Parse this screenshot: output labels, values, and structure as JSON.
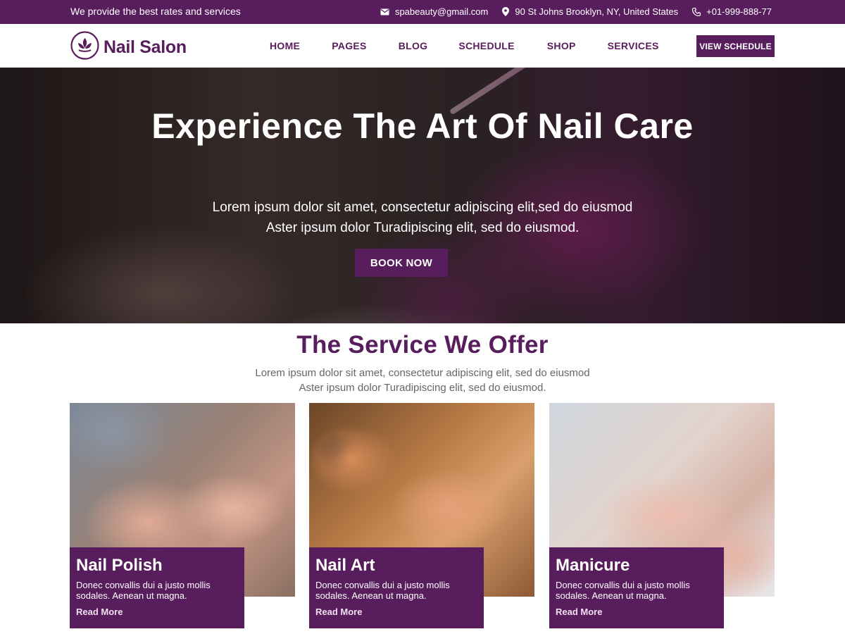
{
  "topbar": {
    "tagline": "We provide the best rates and services",
    "email": "spabeauty@gmail.com",
    "address": "90 St Johns Brooklyn, NY, United States",
    "phone": "+01-999-888-77"
  },
  "header": {
    "logo_text": "Nail Salon",
    "nav": [
      "HOME",
      "PAGES",
      "BLOG",
      "SCHEDULE",
      "SHOP",
      "SERVICES"
    ],
    "cta": "VIEW SCHEDULE"
  },
  "hero": {
    "title": "Experience The Art Of Nail Care",
    "subtitle_line1": "Lorem ipsum dolor sit amet, consectetur adipiscing elit,sed do eiusmod",
    "subtitle_line2": "Aster ipsum dolor Turadipiscing elit, sed do eiusmod.",
    "button": "BOOK NOW"
  },
  "services": {
    "title": "The Service We Offer",
    "subtitle_line1": "Lorem ipsum dolor sit amet, consectetur adipiscing elit, sed do eiusmod",
    "subtitle_line2": "Aster ipsum dolor Turadipiscing elit, sed do eiusmod.",
    "cards": [
      {
        "title": "Nail Polish",
        "desc": "Donec convallis dui a justo mollis sodales. Aenean ut magna.",
        "link": "Read More"
      },
      {
        "title": "Nail Art",
        "desc": "Donec convallis dui a justo mollis sodales. Aenean ut magna.",
        "link": "Read More"
      },
      {
        "title": "Manicure",
        "desc": "Donec convallis dui a justo mollis sodales. Aenean ut magna.",
        "link": "Read More"
      }
    ]
  },
  "colors": {
    "brand": "#581d5c",
    "white": "#ffffff",
    "muted_text": "#666666"
  },
  "icons": {
    "email": "envelope-icon",
    "address": "map-pin-icon",
    "phone": "phone-icon",
    "logo": "lotus-icon"
  }
}
